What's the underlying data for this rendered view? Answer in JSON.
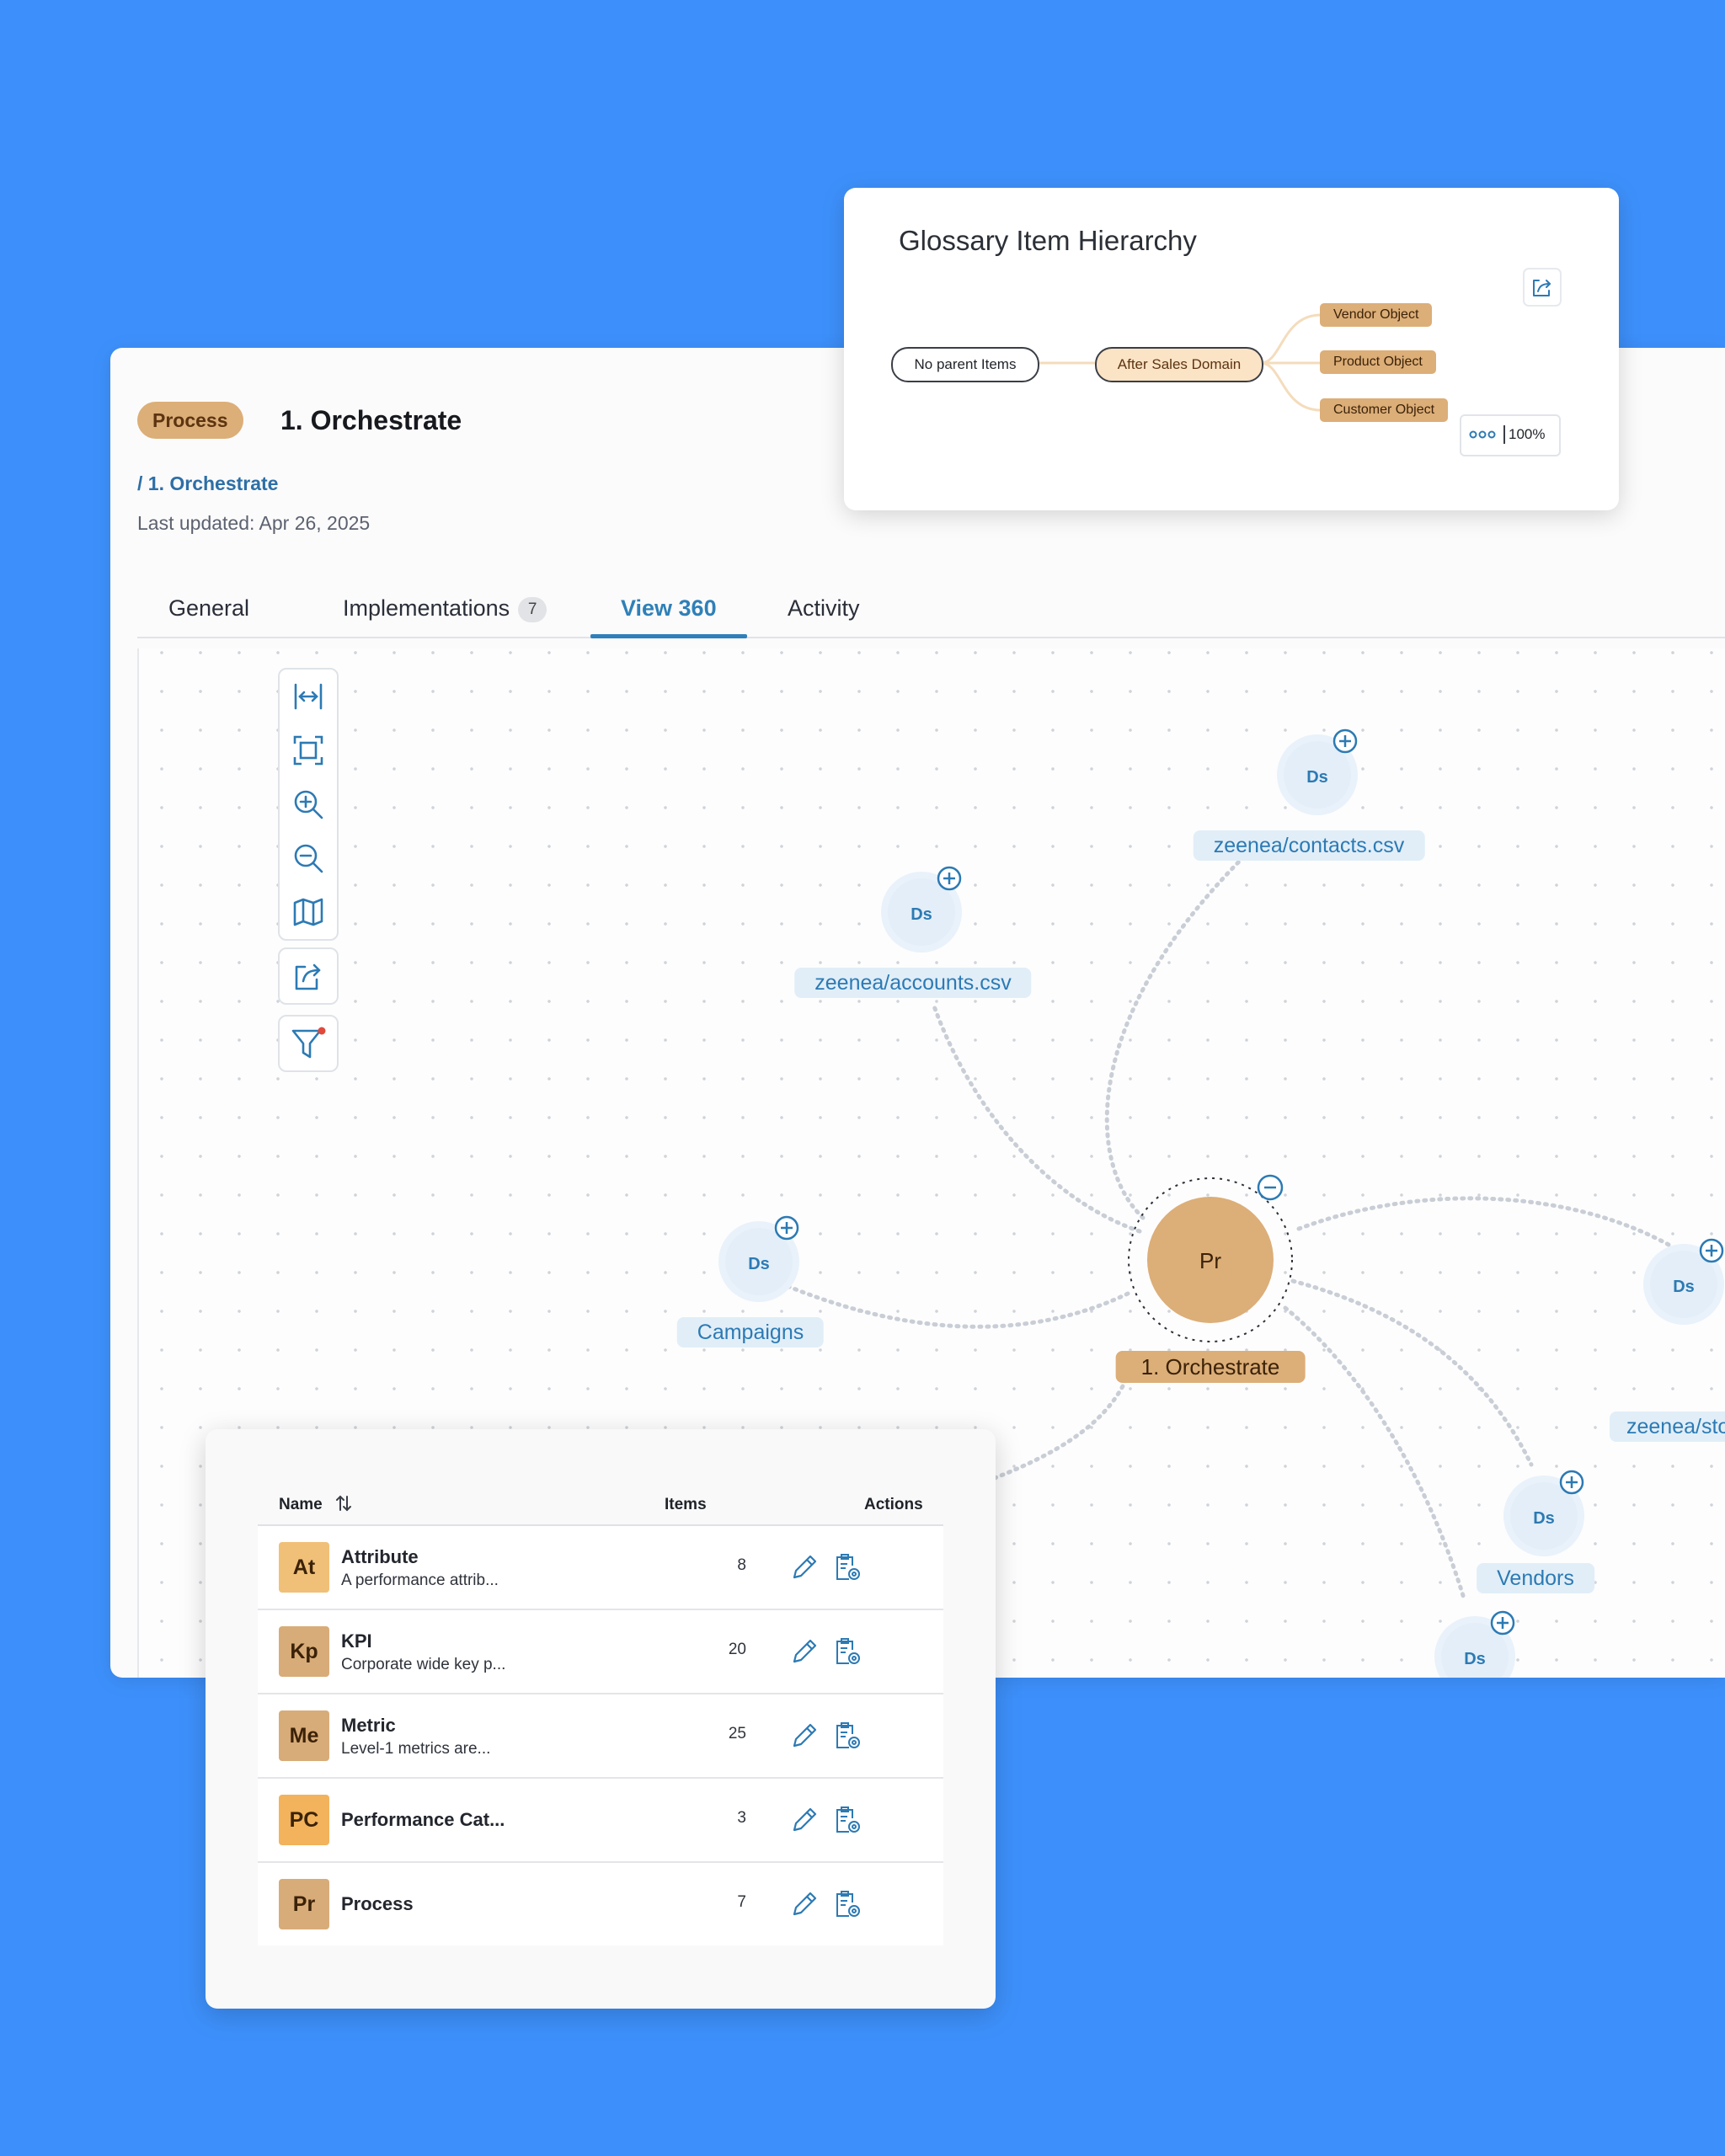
{
  "header": {
    "badge": "Process",
    "title": "1. Orchestrate",
    "breadcrumb": "/ 1. Orchestrate",
    "last_updated": "Last updated: Apr 26, 2025"
  },
  "tabs": [
    {
      "label": "General"
    },
    {
      "label": "Implementations",
      "count": "7"
    },
    {
      "label": "View 360",
      "active": true
    },
    {
      "label": "Activity"
    }
  ],
  "toolbar": {
    "icons": [
      "fit-width-icon",
      "fit-screen-icon",
      "zoom-in-icon",
      "zoom-out-icon",
      "map-icon",
      "export-icon",
      "filter-icon"
    ],
    "filter_indicator_color": "#e0493b"
  },
  "graph": {
    "center": {
      "initials": "Pr",
      "label": "1. Orchestrate"
    },
    "nodes": [
      {
        "initials": "Ds",
        "label": "zeenea/contacts.csv"
      },
      {
        "initials": "Ds",
        "label": "zeenea/accounts.csv"
      },
      {
        "initials": "Ds",
        "label": "Campaigns"
      },
      {
        "initials": "Ds",
        "label": "zeenea/stores."
      },
      {
        "initials": "Ds",
        "label": "Vendors"
      },
      {
        "initials": "Ds",
        "label": ""
      }
    ]
  },
  "glossary": {
    "title": "Glossary Item Hierarchy",
    "parent": "No parent Items",
    "current": "After Sales Domain",
    "children": [
      "Vendor Object",
      "Product Object",
      "Customer Object"
    ],
    "zoom": "100%"
  },
  "table": {
    "columns": {
      "name": "Name",
      "items": "Items",
      "actions": "Actions"
    },
    "rows": [
      {
        "initials": "At",
        "name": "Attribute",
        "description": "A performance attrib...",
        "items": "8",
        "color": "#f0c078"
      },
      {
        "initials": "Kp",
        "name": "KPI",
        "description": "Corporate wide key p...",
        "items": "20",
        "color": "#d8ac78"
      },
      {
        "initials": "Me",
        "name": "Metric",
        "description": "Level-1 metrics are...",
        "items": "25",
        "color": "#d8ac78"
      },
      {
        "initials": "PC",
        "name": "Performance Cat...",
        "description": "",
        "items": "3",
        "color": "#f2b35c"
      },
      {
        "initials": "Pr",
        "name": "Process",
        "description": "",
        "items": "7",
        "color": "#d8ac78"
      }
    ]
  },
  "colors": {
    "background": "#3d90fb",
    "accent": "#2f80b8",
    "process": "#dcae78",
    "dataset_node": "#e1eef8"
  }
}
